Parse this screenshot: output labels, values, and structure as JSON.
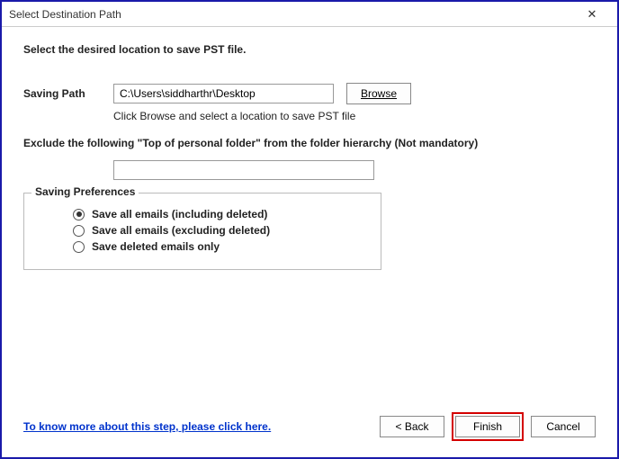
{
  "titlebar": {
    "title": "Select Destination Path",
    "close": "✕"
  },
  "instruction": "Select the desired location to save PST file.",
  "savingPath": {
    "label": "Saving Path",
    "value": "C:\\Users\\siddharthr\\Desktop",
    "browse": "Browse",
    "hint": "Click Browse and select a location to save PST file"
  },
  "exclude": {
    "label": "Exclude the following \"Top of personal folder\" from the folder hierarchy  (Not mandatory)",
    "value": ""
  },
  "prefs": {
    "legend": "Saving Preferences",
    "options": [
      {
        "label": "Save all emails (including deleted)",
        "selected": true
      },
      {
        "label": "Save all emails (excluding deleted)",
        "selected": false
      },
      {
        "label": "Save deleted emails only",
        "selected": false
      }
    ]
  },
  "help": "To know more about this step, please click here.",
  "buttons": {
    "back": "< Back",
    "finish": "Finish",
    "cancel": "Cancel"
  }
}
